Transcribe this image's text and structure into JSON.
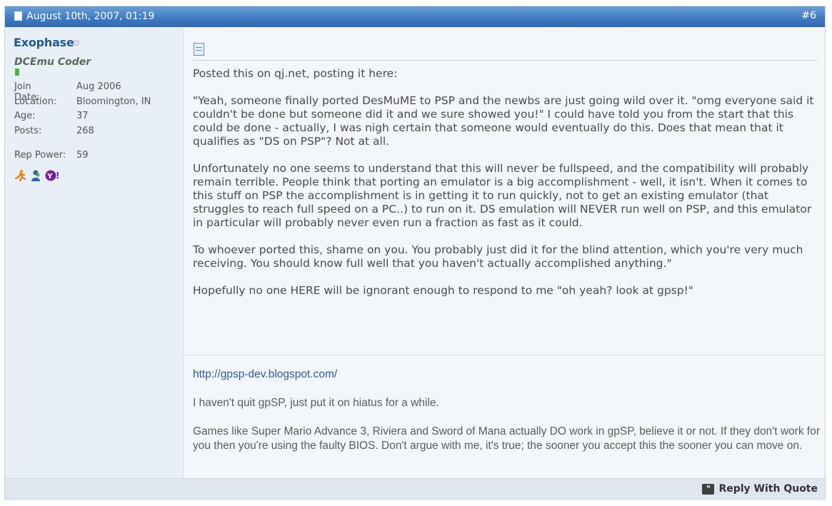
{
  "post": {
    "date": "August 10th, 2007, 01:19",
    "number": "#6"
  },
  "user": {
    "name": "Exophase",
    "title": "DCEmu Coder",
    "stats": [
      {
        "label": "Join Date:",
        "value": "Aug 2006"
      },
      {
        "label": "Location:",
        "value": "Bloomington, IN"
      },
      {
        "label": "Age:",
        "value": "37"
      },
      {
        "label": "Posts:",
        "value": "268"
      }
    ],
    "rep_power_label": "Rep Power:",
    "rep_power_value": "59",
    "im_icons": [
      "aim-icon",
      "msn-icon",
      "yahoo-icon"
    ]
  },
  "message": {
    "paragraphs": [
      "Posted this on qj.net, posting it here:",
      "\"Yeah, someone finally ported DesMuME to PSP and the newbs are just going wild over it. \"omg everyone said it couldn't be done but someone did it and we sure showed you!\" I could have told you from the start that this could be done - actually, I was nigh certain that someone would eventually do this. Does that mean that it qualifies as \"DS on PSP\"? Not at all.",
      "Unfortunately no one seems to understand that this will never be fullspeed, and the compatibility will probably remain terrible. People think that porting an emulator is a big accomplishment - well, it isn't. When it comes to this stuff on PSP the accomplishment is in getting it to run quickly, not to get an existing emulator (that struggles to reach full speed on a PC..) to run on it. DS emulation will NEVER run well on PSP, and this emulator in particular will probably never even run a fraction as fast as it could.",
      "To whoever ported this, shame on you. You probably just did it for the blind attention, which you're very much receiving. You should know full well that you haven't actually accomplished anything.\"",
      "Hopefully no one HERE will be ignorant enough to respond to me \"oh yeah? look at gpsp!\""
    ]
  },
  "signature": {
    "link": "http://gpsp-dev.blogspot.com/",
    "line1": "I haven't quit gpSP, just put it on hiatus for a while.",
    "line2": "Games like Super Mario Advance 3, Riviera and Sword of Mana actually DO work in gpSP, believe it or not. If they don't work for you then you're using the faulty BIOS. Don't argue with me, it's true; the sooner you accept this the sooner you can move on."
  },
  "footer": {
    "reply_label": "Reply With Quote"
  },
  "colors": {
    "header_blue": "#3d78c0",
    "username": "#23588f",
    "link": "#2d5d93",
    "rep_green": "#49b446"
  }
}
